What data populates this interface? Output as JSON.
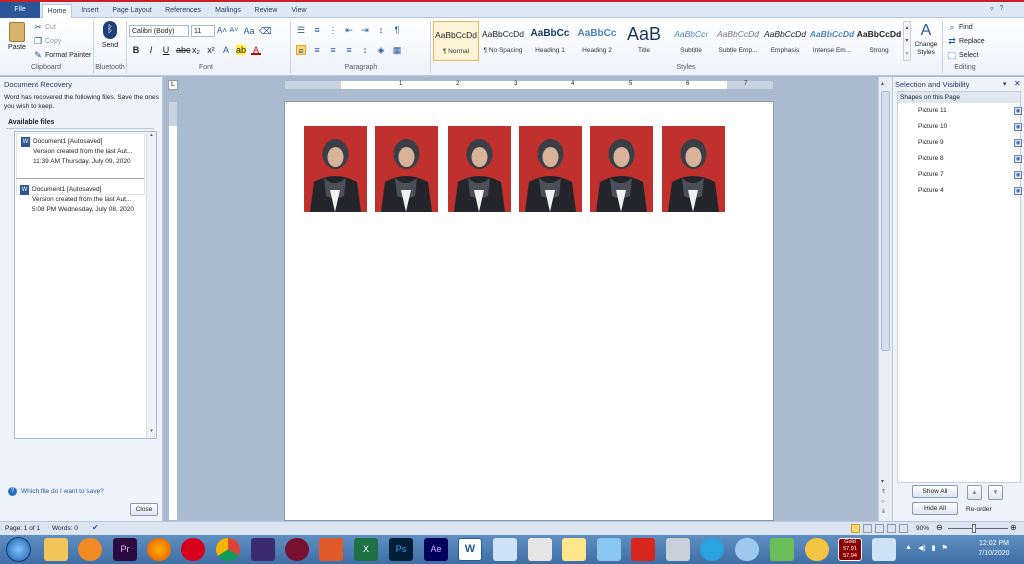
{
  "tabs": [
    "File",
    "Home",
    "Insert",
    "Page Layout",
    "References",
    "Mailings",
    "Review",
    "View"
  ],
  "clipboard": {
    "paste": "Paste",
    "cut": "Cut",
    "copy": "Copy",
    "format_painter": "Format Painter",
    "label": "Clipboard"
  },
  "bluetooth": {
    "send": "Send",
    "label": "Bluetooth"
  },
  "font": {
    "name": "Calibri (Body)",
    "size": "11",
    "label": "Font"
  },
  "paragraph": {
    "label": "Paragraph"
  },
  "styles": {
    "label": "Styles",
    "items": [
      {
        "preview": "AaBbCcDd",
        "name": "¶ Normal"
      },
      {
        "preview": "AaBbCcDd",
        "name": "¶ No Spacing"
      },
      {
        "preview": "AaBbCc",
        "name": "Heading 1"
      },
      {
        "preview": "AaBbCc",
        "name": "Heading 2"
      },
      {
        "preview": "AaB",
        "name": "Title"
      },
      {
        "preview": "AaBbCcı",
        "name": "Subtitle"
      },
      {
        "preview": "AaBbCcDd",
        "name": "Subtle Emp..."
      },
      {
        "preview": "AaBbCcDd",
        "name": "Emphasis"
      },
      {
        "preview": "AaBbCcDd",
        "name": "Intense Em..."
      },
      {
        "preview": "AaBbCcDd",
        "name": "Strong"
      }
    ],
    "change_styles": "Change Styles"
  },
  "editing": {
    "find": "Find",
    "replace": "Replace",
    "select": "Select",
    "label": "Editing"
  },
  "recovery": {
    "title": "Document Recovery",
    "message": "Word has recovered the following files.  Save the ones you wish to keep.",
    "available": "Available files",
    "files": [
      {
        "name": "Document1  [Autosaved]",
        "desc": "Version created from the last Aut...",
        "time": "11:39 AM Thursday, July 09, 2020"
      },
      {
        "name": "Document1  [Autosaved]",
        "desc": "Version created from the last Aut...",
        "time": "5:08 PM Wednesday, July 08, 2020"
      }
    ],
    "help": "Which file do I want to save?",
    "close": "Close"
  },
  "selection": {
    "title": "Selection and Visibility",
    "subtitle": "Shapes on this Page",
    "shapes": [
      "Picture 11",
      "Picture 10",
      "Picture 9",
      "Picture 8",
      "Picture 7",
      "Picture 4"
    ],
    "show_all": "Show All",
    "hide_all": "Hide All",
    "reorder": "Re-order"
  },
  "ruler": [
    "1",
    "2",
    "3",
    "4",
    "5",
    "6",
    "7"
  ],
  "status": {
    "page": "Page: 1 of 1",
    "words": "Words: 0",
    "zoom": "90%"
  },
  "taskbar": {
    "gold": "Gold",
    "gold1": "57.91",
    "gold2": "57.94",
    "time": "12:02 PM",
    "date": "7/10/2020"
  }
}
